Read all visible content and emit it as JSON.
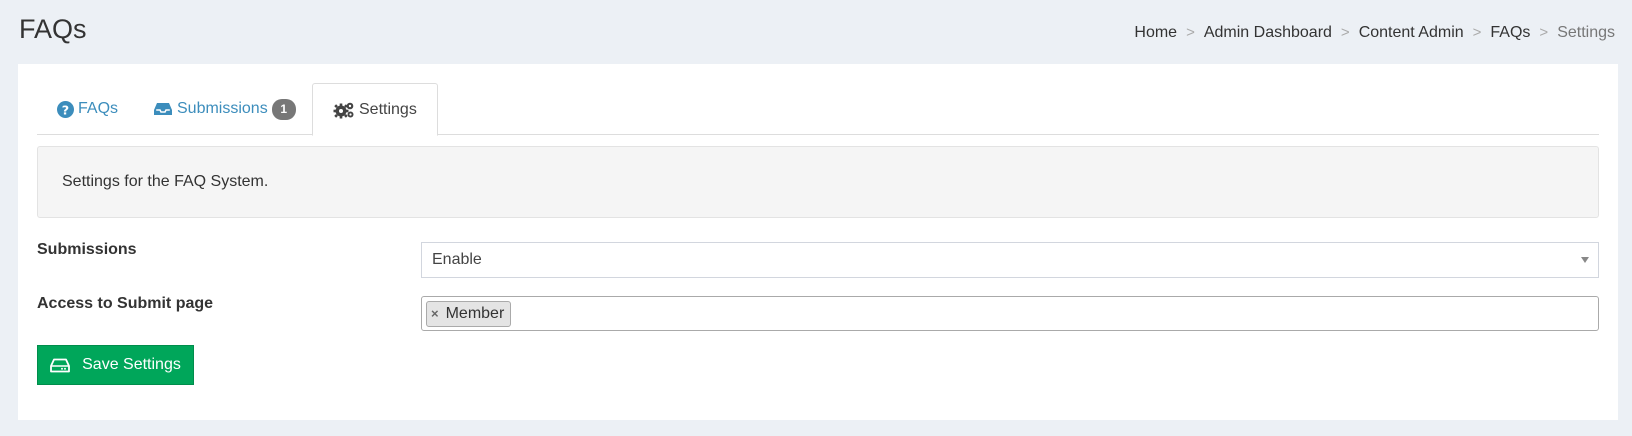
{
  "header": {
    "title": "FAQs"
  },
  "breadcrumb": {
    "items": [
      "Home",
      "Admin Dashboard",
      "Content Admin",
      "FAQs"
    ],
    "separator": ">",
    "current": "Settings"
  },
  "tabs": [
    {
      "label": "FAQs",
      "icon": "question-circle-icon"
    },
    {
      "label": "Submissions",
      "icon": "inbox-icon",
      "badge": "1"
    },
    {
      "label": "Settings",
      "icon": "gears-icon",
      "active": true
    }
  ],
  "info": {
    "text": "Settings for the FAQ System."
  },
  "form": {
    "submissions_label": "Submissions",
    "submissions_value": "Enable",
    "access_label": "Access to Submit page",
    "access_tags": [
      "Member"
    ],
    "tag_remove_glyph": "×"
  },
  "actions": {
    "save_label": "Save Settings",
    "save_icon": "hdd-icon"
  },
  "colors": {
    "link": "#3c8dbc",
    "success": "#00a65a",
    "badge": "#777777",
    "background": "#ecf0f5"
  }
}
